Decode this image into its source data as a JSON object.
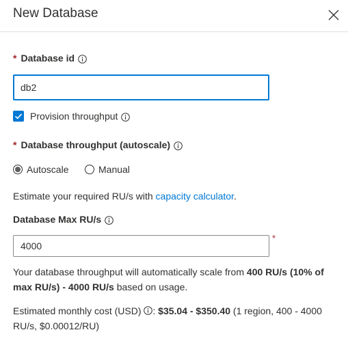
{
  "panel": {
    "title": "New Database"
  },
  "database_id": {
    "label": "Database id",
    "value": "db2"
  },
  "provision": {
    "label": "Provision throughput",
    "checked": true
  },
  "throughput": {
    "label": "Database throughput (autoscale)",
    "options": [
      {
        "label": "Autoscale",
        "selected": true
      },
      {
        "label": "Manual",
        "selected": false
      }
    ]
  },
  "estimate": {
    "prefix": "Estimate your required RU/s with ",
    "link": "capacity calculator",
    "suffix": "."
  },
  "max_ru": {
    "label": "Database Max RU/s",
    "value": "4000"
  },
  "scale_note": {
    "prefix": "Your database throughput will automatically scale from ",
    "bold": "400 RU/s (10% of max RU/s) - 4000 RU/s",
    "suffix": " based on usage."
  },
  "cost": {
    "prefix": "Estimated monthly cost (USD) ",
    "colon": ": ",
    "bold": "$35.04 - $350.40",
    "suffix": " (1 region, 400 - 4000 RU/s, $0.00012/RU)"
  },
  "required_mark": "*",
  "colors": {
    "accent": "#0078d4",
    "required": "#a4262c",
    "text": "#323130"
  }
}
